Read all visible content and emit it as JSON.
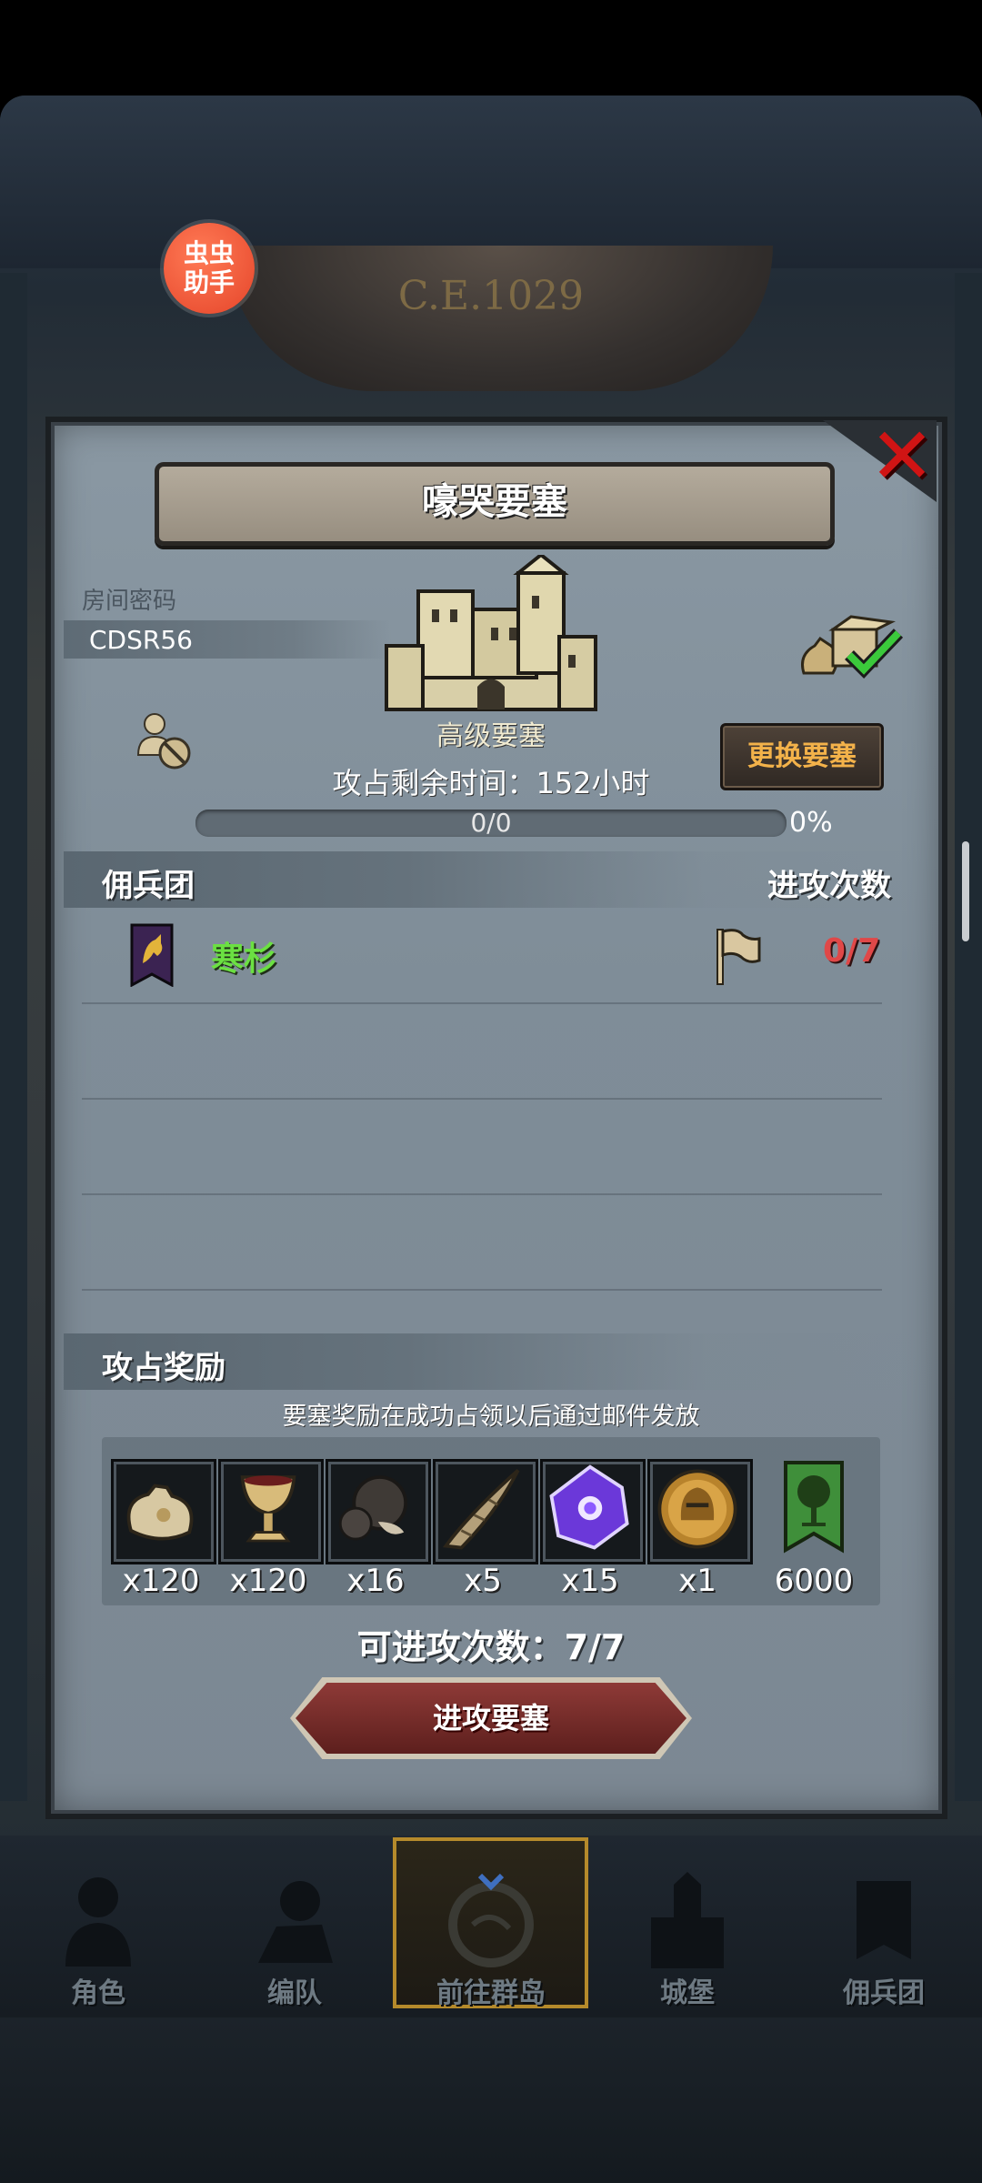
{
  "header": {
    "era_text": "C.E.1029",
    "assistant_badge": "虫虫\n助手"
  },
  "dialog": {
    "title": "嚎哭要塞",
    "room": {
      "label": "房间密码",
      "code": "CDSR56"
    },
    "fortress": {
      "name": "高级要塞",
      "change_button": "更换要塞"
    },
    "occupy_time": "攻占剩余时间：152小时",
    "progress": {
      "text": "0/0",
      "percent_text": "0%",
      "fraction": 0
    },
    "mercenary_section": {
      "title": "佣兵团",
      "attack_count_header": "进攻次数"
    },
    "guilds": [
      {
        "name": "寒杉",
        "attacks": "0/7"
      }
    ],
    "rewards": {
      "title": "攻占奖励",
      "notice": "要塞奖励在成功占领以后通过邮件发放",
      "items": [
        {
          "icon": "sack-icon",
          "qty": "x120"
        },
        {
          "icon": "goblet-icon",
          "qty": "x120"
        },
        {
          "icon": "truffle-icon",
          "qty": "x16"
        },
        {
          "icon": "horn-icon",
          "qty": "x5"
        },
        {
          "icon": "purple-crystal-icon",
          "qty": "x15"
        },
        {
          "icon": "knight-medal-icon",
          "qty": "x1"
        },
        {
          "icon": "tree-banner-icon",
          "qty": "6000"
        }
      ]
    },
    "available_attacks": "可进攻次数：7/7",
    "attack_button": "进攻要塞"
  },
  "nav": {
    "items": [
      {
        "label": "角色",
        "icon": "character-icon"
      },
      {
        "label": "编队",
        "icon": "formation-icon"
      },
      {
        "label": "前往群岛",
        "icon": "islands-icon"
      },
      {
        "label": "城堡",
        "icon": "castle-icon"
      },
      {
        "label": "佣兵团",
        "icon": "mercenary-icon"
      }
    ]
  },
  "colors": {
    "guild_name": "#6be042",
    "attack_count": "#e04848",
    "change_button_text": "#f3b24a",
    "close": "#d01414"
  }
}
